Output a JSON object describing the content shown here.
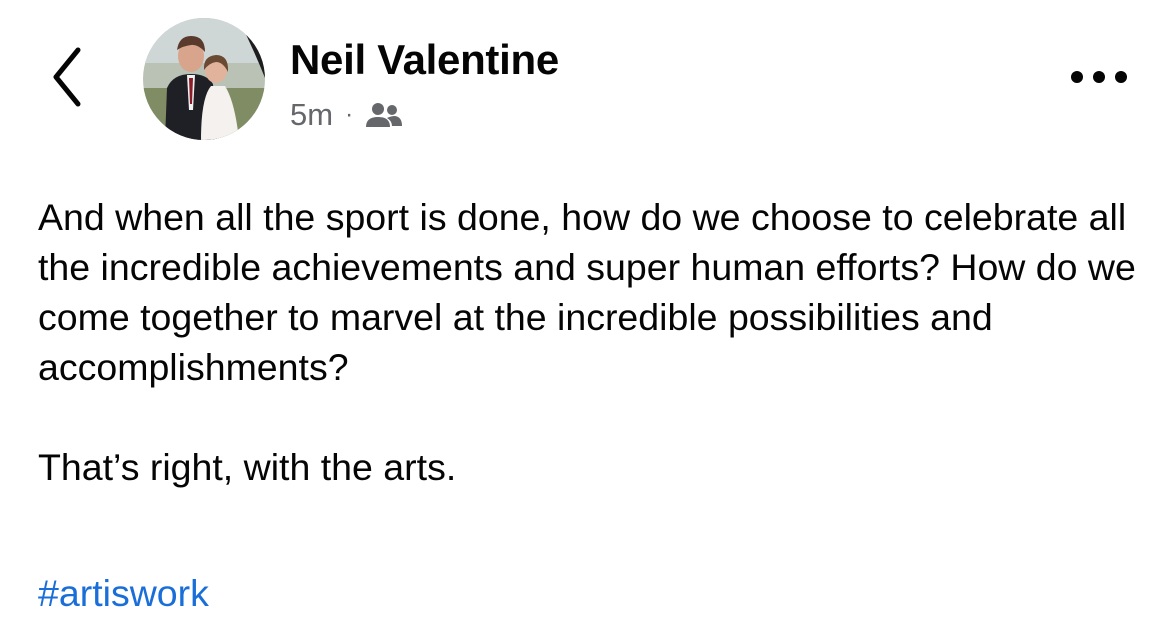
{
  "header": {
    "back_icon": "chevron-left-icon",
    "author_name": "Neil Valentine",
    "time_ago": "5m",
    "separator": "·",
    "audience_icon": "friends-icon",
    "more_icon": "more-horizontal-icon"
  },
  "post": {
    "paragraphs": [
      "And when all the sport is done, how do we choose to celebrate all the incredible achievements and super human efforts? How do we come together to marvel at the incredible possibilities and accomplishments?",
      "That’s right, with the arts."
    ],
    "hashtag": "#artiswork"
  },
  "colors": {
    "text": "#050505",
    "meta": "#65676b",
    "link": "#1a6ed8"
  }
}
